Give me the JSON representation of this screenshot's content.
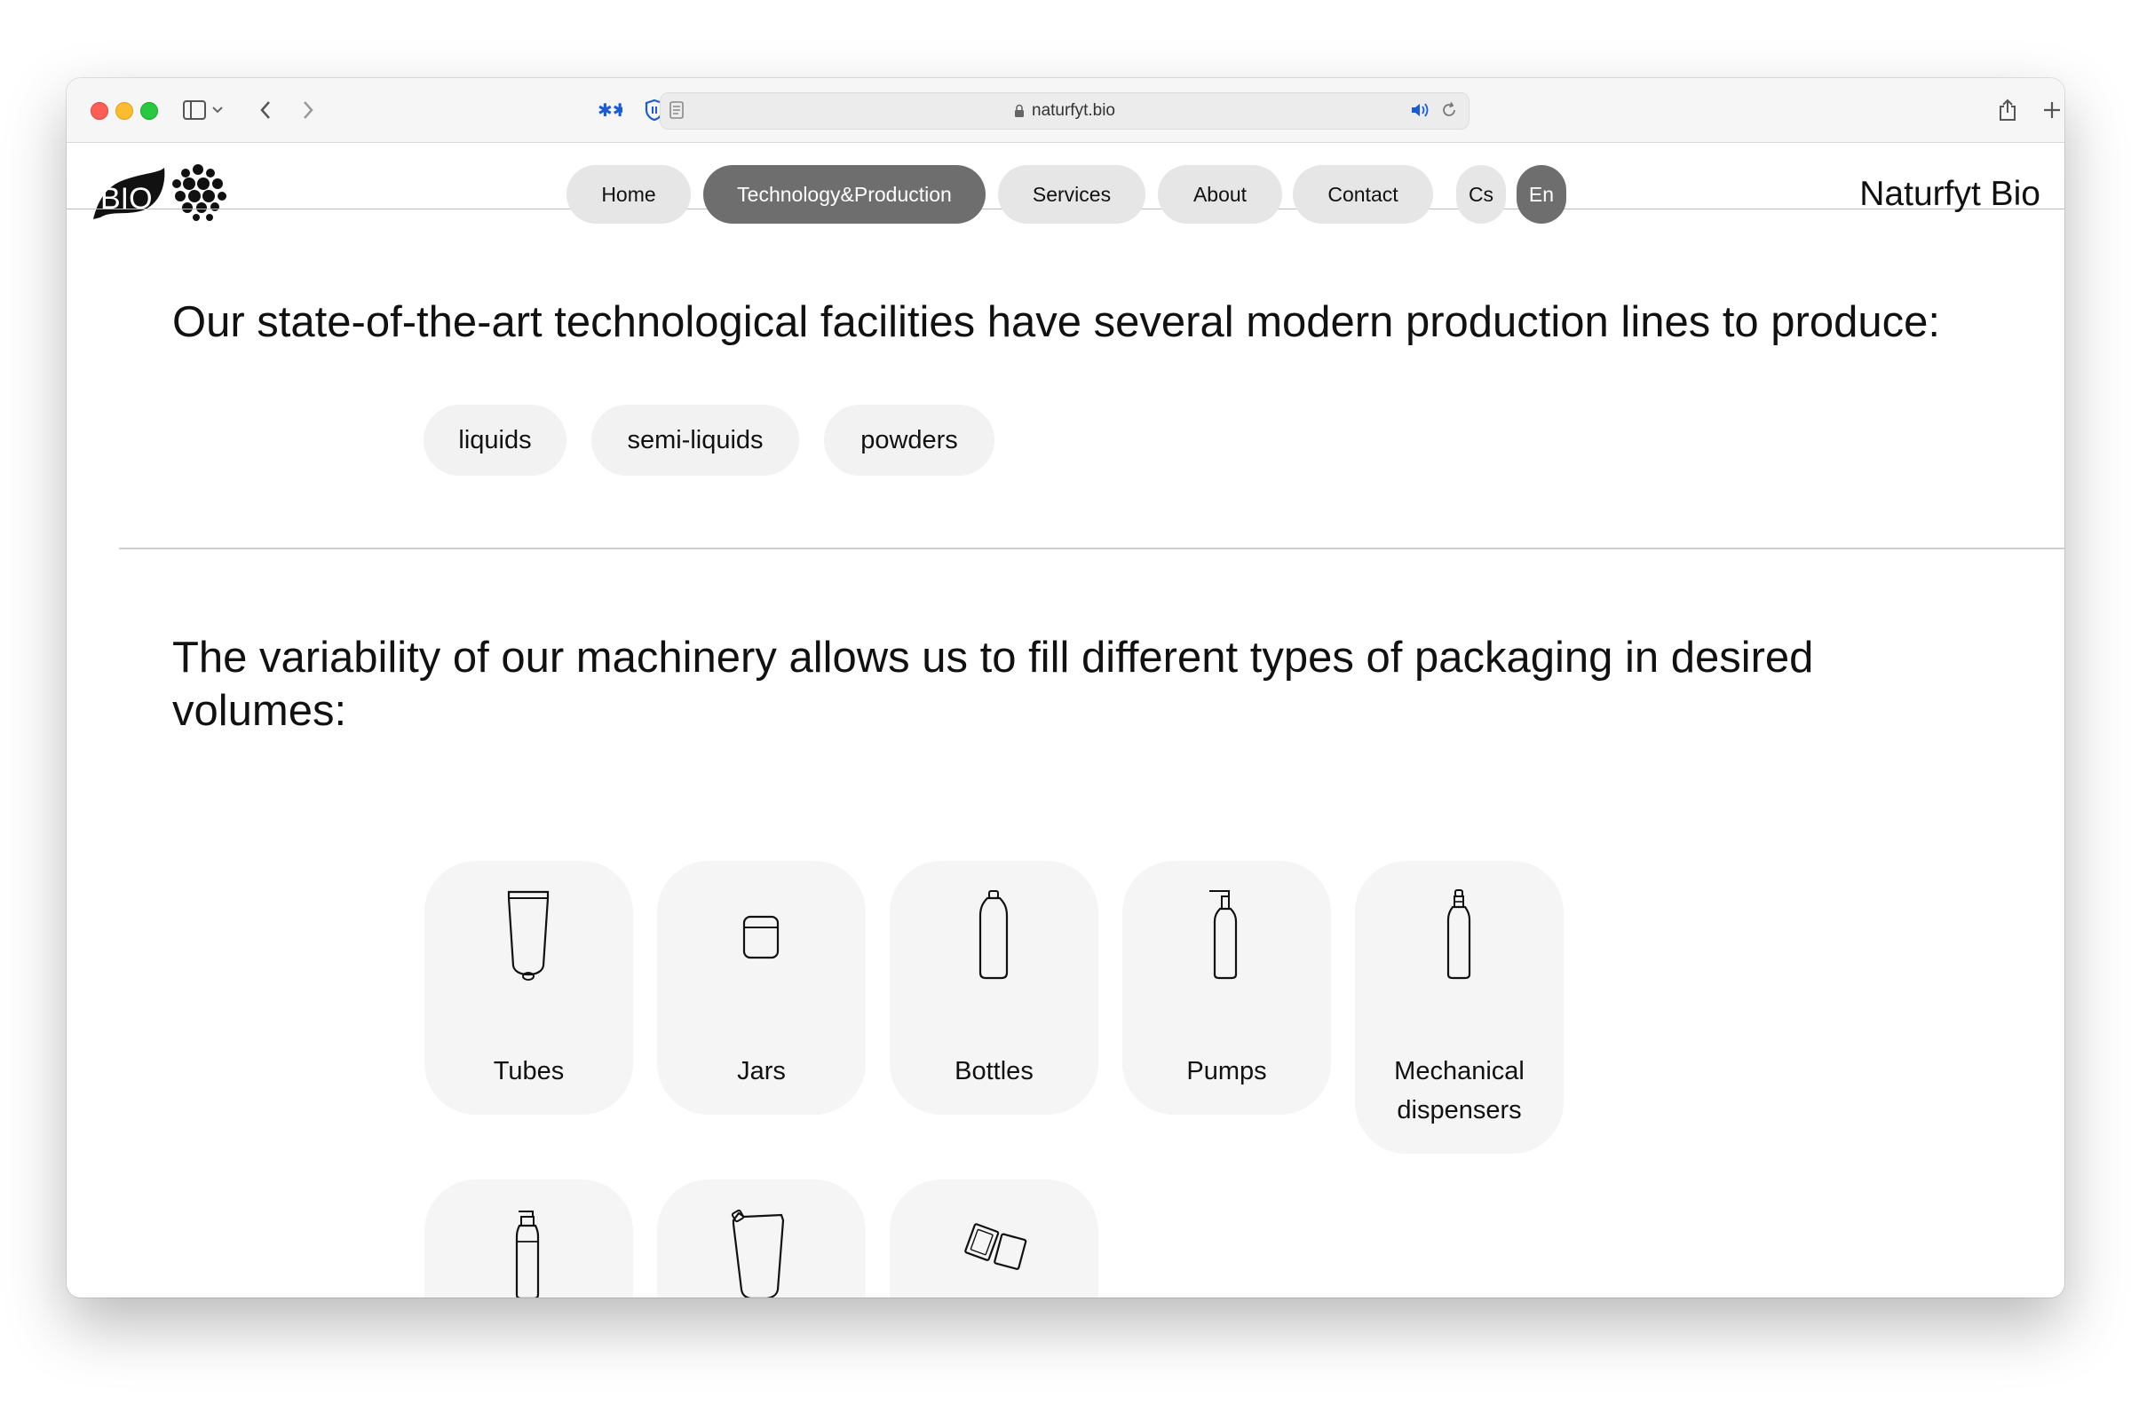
{
  "browser": {
    "url": "naturfyt.bio",
    "icons": [
      "sidebar-icon",
      "chevron-down-icon",
      "back-icon",
      "forward-icon",
      "extension-icon",
      "shield-icon",
      "privacy-icon",
      "page-icon",
      "lock-icon",
      "audio-icon",
      "reload-icon",
      "share-icon",
      "new-tab-icon",
      "tab-overview-icon"
    ]
  },
  "site": {
    "brand": "Naturfyt Bio",
    "logo_text": "BIO",
    "nav": [
      {
        "label": "Home",
        "active": false
      },
      {
        "label": "Technology&Production",
        "active": true
      },
      {
        "label": "Services",
        "active": false
      },
      {
        "label": "About",
        "active": false
      },
      {
        "label": "Contact",
        "active": false
      },
      {
        "label": "Cs",
        "active": false
      },
      {
        "label": "En",
        "active": true
      }
    ]
  },
  "section1": {
    "heading": "Our state-of-the-art technological facilities have several modern production lines to produce:",
    "pills": [
      "liquids",
      "semi-liquids",
      "powders"
    ]
  },
  "section2": {
    "heading_line1": "The variability of our machinery allows us to fill different types of packaging in desired",
    "heading_line2": "volumes:",
    "cards": [
      {
        "label": "Tubes",
        "icon": "tube-icon"
      },
      {
        "label": "Jars",
        "icon": "jar-icon"
      },
      {
        "label": "Bottles",
        "icon": "bottle-icon"
      },
      {
        "label": "Pumps",
        "icon": "pump-bottle-icon"
      },
      {
        "label_line1": "Mechanical",
        "label_line2": "dispensers",
        "icon": "spray-bottle-icon"
      },
      {
        "label": "",
        "icon": "foam-dispenser-icon"
      },
      {
        "label": "",
        "icon": "pouch-icon"
      },
      {
        "label": "",
        "icon": "sachet-icon"
      }
    ]
  },
  "colors": {
    "nav_inactive": "#e6e6e6",
    "nav_active": "#6e6e6e",
    "pill_bg": "#f2f2f2",
    "card_bg": "#f5f5f5"
  }
}
